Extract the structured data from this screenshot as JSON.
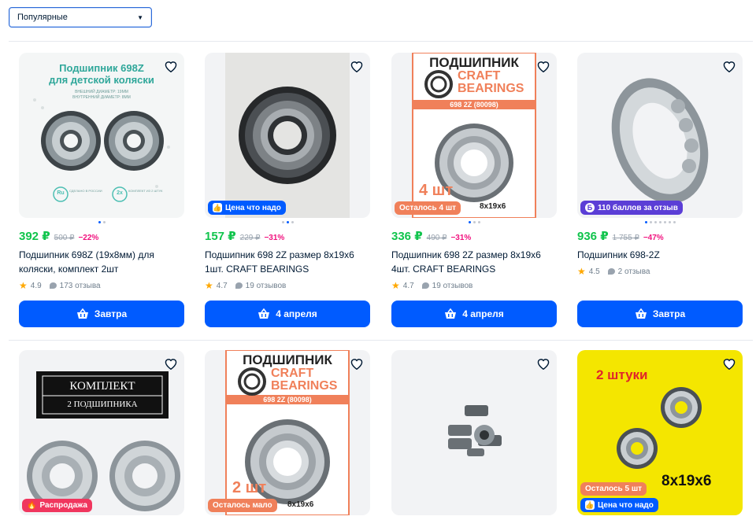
{
  "sort": {
    "selected": "Популярные"
  },
  "products": [
    {
      "price": "392 ₽",
      "old_price": "500 ₽",
      "discount": "−22%",
      "title": "Подшипник 698Z (19х8мм) для коляски, комплект 2шт",
      "rating": "4.9",
      "reviews": "173 отзыва",
      "button": "Завтра",
      "dots": 2,
      "active_dot": 0,
      "image_text": {
        "headline": "Подшипник 698Z",
        "subline": "для детской коляски",
        "spec1": "ВНЕШНИЙ ДИАМЕТР: 19ММ",
        "spec2": "ВНУТРЕННИЙ ДИАМЕТР: 8ММ",
        "chip1": "Ru",
        "chip1_label": "СДЕЛАНО В РОССИИ",
        "chip2": "2x",
        "chip2_label": "КОМПЛЕКТ ИЗ 2 ШТУК"
      },
      "badges": []
    },
    {
      "price": "157 ₽",
      "old_price": "229 ₽",
      "discount": "−31%",
      "title": "Подшипник 698 2Z размер 8х19х6 1шт. CRAFT BEARINGS",
      "rating": "4.7",
      "reviews": "19 отзывов",
      "button": "4 апреля",
      "dots": 3,
      "active_dot": 1,
      "badges": [
        {
          "style": "blue",
          "icon": "thumb-up-icon",
          "text": "Цена что надо"
        }
      ]
    },
    {
      "price": "336 ₽",
      "old_price": "490 ₽",
      "discount": "−31%",
      "title": "Подшипник 698 2Z размер 8х19х6 4шт. CRAFT BEARINGS",
      "rating": "4.7",
      "reviews": "19 отзывов",
      "button": "4 апреля",
      "dots": 3,
      "active_dot": 0,
      "image_text": {
        "headline": "ПОДШИПНИК",
        "brand1": "CRAFT",
        "brand2": "BEARINGS",
        "model": "698 2Z (80098)",
        "qty": "4 шт",
        "size": "8x19x6"
      },
      "badges": [
        {
          "style": "orange",
          "icon": "",
          "text": "Осталось 4 шт"
        }
      ]
    },
    {
      "price": "936 ₽",
      "old_price": "1 755 ₽",
      "discount": "−47%",
      "title": "Подшипник 698-2Z",
      "rating": "4.5",
      "reviews": "2 отзыва",
      "button": "Завтра",
      "dots": 7,
      "active_dot": 0,
      "badges": [
        {
          "style": "purple",
          "icon": "points-icon",
          "text": "110 баллов за отзыв"
        }
      ]
    },
    {
      "image_text": {
        "line1": "КОМПЛЕКТ",
        "line2": "2 ПОДШИПНИКА"
      },
      "badges": [
        {
          "style": "pink",
          "icon": "fire-icon",
          "text": "Распродажа"
        }
      ]
    },
    {
      "image_text": {
        "headline": "ПОДШИПНИК",
        "brand1": "CRAFT",
        "brand2": "BEARINGS",
        "model": "698 2Z (80098)",
        "qty": "2 шт",
        "size": "8x19x6"
      },
      "badges": [
        {
          "style": "orange",
          "icon": "",
          "text": "Осталось мало"
        }
      ]
    },
    {
      "badges": []
    },
    {
      "image_text": {
        "headline": "2 штуки",
        "size": "8x19x6"
      },
      "badges": [
        {
          "style": "orange",
          "icon": "",
          "text": "Осталось 5 шт"
        },
        {
          "style": "blue",
          "icon": "thumb-up-icon",
          "text": "Цена что надо"
        }
      ]
    }
  ],
  "colors": {
    "accent": "#005bff",
    "price": "#10c44c",
    "discount": "#f1117e",
    "rating_star": "#ffa800",
    "craft_orange": "#f0805a",
    "yellow_bg": "#f4e600"
  }
}
